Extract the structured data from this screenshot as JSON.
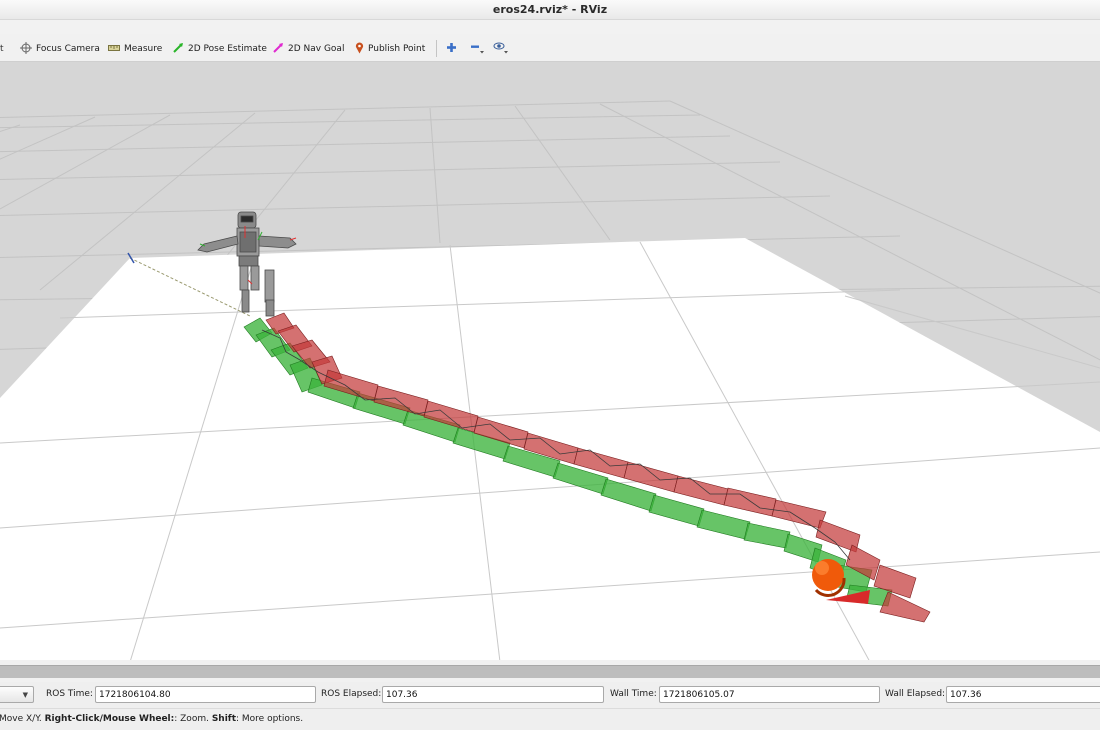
{
  "window": {
    "title": "eros24.rviz* - RViz"
  },
  "toolbar": {
    "tools": [
      {
        "label": "Focus Camera",
        "icon": "focus-camera-icon"
      },
      {
        "label": "Measure",
        "icon": "ruler-icon"
      },
      {
        "label": "2D Pose Estimate",
        "icon": "green-arrow-icon"
      },
      {
        "label": "2D Nav Goal",
        "icon": "magenta-arrow-icon"
      },
      {
        "label": "Publish Point",
        "icon": "map-pin-icon"
      }
    ],
    "actions": [
      {
        "icon": "plus-icon"
      },
      {
        "icon": "minus-icon"
      },
      {
        "icon": "eye-icon"
      }
    ]
  },
  "time": {
    "ros_time_label": "ROS Time:",
    "ros_time": "1721806104.80",
    "ros_elapsed_label": "ROS Elapsed:",
    "ros_elapsed": "107.36",
    "wall_time_label": "Wall Time:",
    "wall_time": "1721806105.07",
    "wall_elapsed_label": "Wall Elapsed:",
    "wall_elapsed": "107.36"
  },
  "status": {
    "part1": "Move X/Y. ",
    "part2": "Right-Click/Mouse Wheel:",
    "part3": ": Zoom. ",
    "part4": "Shift",
    "part5": ": More options."
  },
  "colors": {
    "footstep_green": "#3cb43c",
    "footstep_red": "#c43a3a",
    "goal_marker": "#f05a0a",
    "ground_plane": "#ffffff",
    "background": "#d6d6d6"
  }
}
